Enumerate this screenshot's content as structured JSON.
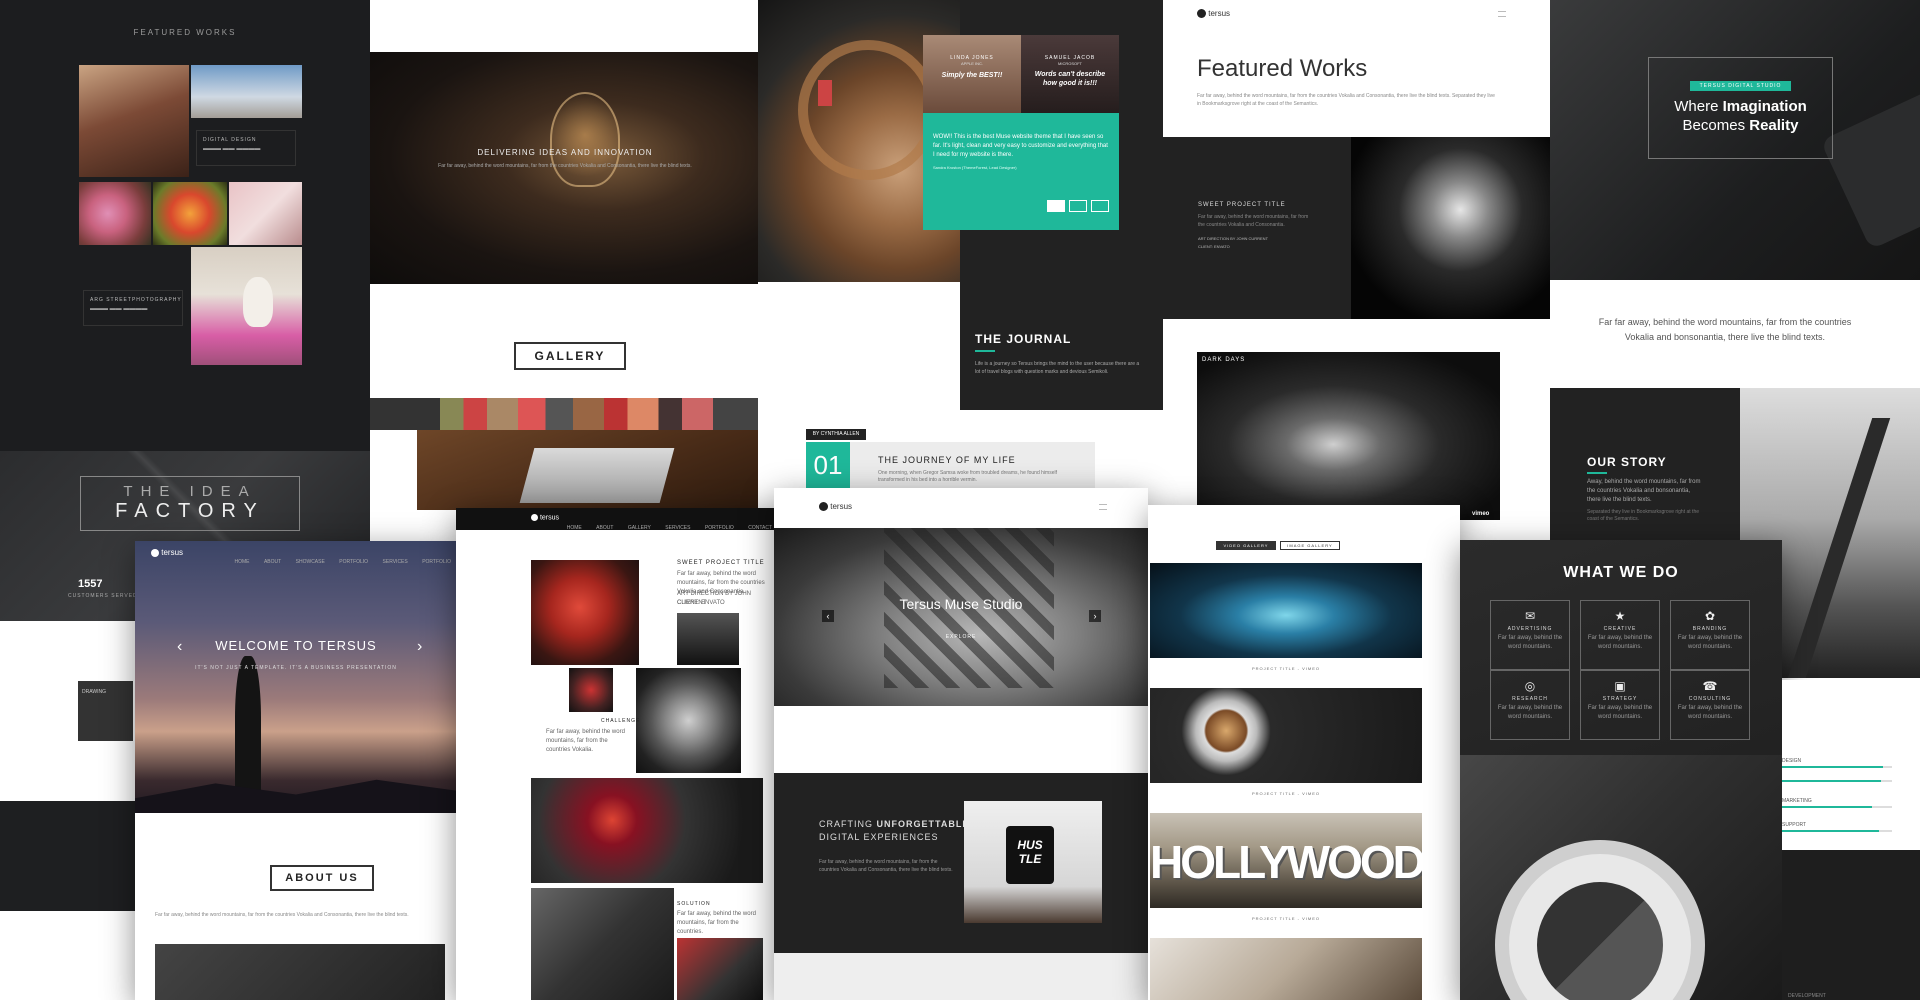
{
  "brand": {
    "name": "tersus"
  },
  "featured_dark": {
    "heading": "FEATURED WORKS",
    "caption1_title": "DIGITAL DESIGN",
    "caption2_title": "ARG STREETPHOTOGRAPHY"
  },
  "bulb_panel": {
    "heading": "DELIVERING IDEAS AND INNOVATION",
    "body": "Far far away, behind the word mountains, far from the countries Vokalia and Consonantia, there live the blind texts.",
    "gallery_button": "GALLERY"
  },
  "idea_factory": {
    "line1": "THE IDEA",
    "line2": "FACTORY"
  },
  "stats": {
    "number": "1557",
    "label": "CUSTOMERS SERVED",
    "side_label": "DRAWING"
  },
  "testimonials": {
    "person1_name": "LINDA JONES",
    "person1_role": "APPLE INC.",
    "person1_quote": "Simply the BEST!!",
    "person2_name": "SAMUEL JACOB",
    "person2_role": "MICROSOFT",
    "person2_quote": "Words can't describe how good it is!!!",
    "teal_quote": "WOW!! This is the best Muse website theme that I have seen so far. It's light, clean and very easy to customize and everything that I need for my website is there.",
    "teal_author": "Sandra Kroston (ThemeForest, Lead Designer)"
  },
  "journal": {
    "heading": "THE JOURNAL",
    "body": "Life is a journey so Tersus brings the mind to the user because there are a lot of travel blogs with question marks and devious Semikoli.",
    "author_tag": "BY CYNTHIA ALLEN",
    "day": "01",
    "post_title": "THE JOURNEY OF MY LIFE",
    "post_body": "One morning, when Gregor Samsa woke from troubled dreams, he found himself transformed in his bed into a horrible vermin."
  },
  "featured_light": {
    "title_light": "Featured",
    "title_bold": "Works",
    "body": "Far far away, behind the word mountains, far from the countries Vokalia and Consonantia, there live the blind texts. Separated they live in Bookmarksgrove right at the coast of the Semantics.",
    "project_title": "SWEET PROJECT TITLE",
    "project_body": "Far far away, behind the word mountains, far from the countries Vokalia and Consonantia.",
    "art_direction": "ART DIRECTION BY JOHN CURRENT",
    "client": "CLIENT: ENVATO",
    "dark_days": "DARK DAYS",
    "vimeo": "vimeo"
  },
  "imagination": {
    "tag": "TERSUS DIGITAL STUDIO",
    "line1_light": "Where",
    "line1_bold": "Imagination",
    "line2_light": "Becomes",
    "line2_bold": "Reality",
    "tagline": "Far far away, behind the word mountains, far from the countries Vokalia and bonsonantia, there live the blind texts.",
    "story_heading": "OUR STORY",
    "story_body": "Away, behind the word mountains, far from the countries Vokalia and bonsonantia, there live the blind texts.",
    "story_more": "Separated they live in Bookmarksgrove right at the coast of the Semantics."
  },
  "welcome": {
    "nav": [
      "HOME",
      "ABOUT",
      "SHOWCASE",
      "PORTFOLIO",
      "SERVICES",
      "PORTFOLIO"
    ],
    "hero_title": "WELCOME TO TERSUS",
    "hero_sub": "IT'S NOT JUST A TEMPLATE. IT'S A BUSINESS PRESENTATION",
    "about_button": "ABOUT US",
    "about_body": "Far far away, behind the word mountains, far from the countries Vokalia and Consonantia, there live the blind texts."
  },
  "project_page": {
    "nav": [
      "HOME",
      "ABOUT",
      "GALLERY",
      "SERVICES",
      "PORTFOLIO",
      "CONTACT"
    ],
    "title": "SWEET PROJECT TITLE",
    "body": "Far far away, behind the word mountains, far from the countries Vokalia and Consonantia.",
    "art_direction": "ART DIRECTION BY JOHN CURRENT",
    "client": "CLIENT: ENVATO",
    "challenge": "CHALLENGE",
    "challenge_body": "Far far away, behind the word mountains, far from the countries Vokalia.",
    "solution": "SOLUTION",
    "solution_body": "Far far away, behind the word mountains, far from the countries."
  },
  "muse": {
    "hero_title": "Tersus Muse Studio",
    "explore": "EXPLORE",
    "crafting_light": "CRAFTING",
    "crafting_bold": "UNFORGETTABLE",
    "crafting_line2": "DIGITAL EXPERIENCES",
    "crafting_body": "Far far away, behind the word mountains, far from the countries Vokalia and Consonantia, there live the blind texts.",
    "mug_text": "HUS TLE"
  },
  "video_gallery": {
    "tab1": "VIDEO GALLERY",
    "tab2": "IMAGE GALLERY",
    "caption": "PROJECT TITLE - VIMEO",
    "hollywood": "HOLLYWOOD"
  },
  "what_we_do": {
    "heading": "WHAT WE DO",
    "services": [
      {
        "icon": "megaphone-icon",
        "glyph": "✉",
        "name": "ADVERTISING"
      },
      {
        "icon": "star-icon",
        "glyph": "★",
        "name": "CREATIVE"
      },
      {
        "icon": "lotus-icon",
        "glyph": "✿",
        "name": "BRANDING"
      },
      {
        "icon": "research-icon",
        "glyph": "◎",
        "name": "RESEARCH"
      },
      {
        "icon": "strategy-icon",
        "glyph": "▣",
        "name": "STRATEGY"
      },
      {
        "icon": "consulting-icon",
        "glyph": "☎",
        "name": "CONSULTING"
      }
    ],
    "service_body": "Far far away, behind the word mountains.",
    "skills": [
      {
        "name": "DESIGN",
        "level": 0.92
      },
      {
        "name": "",
        "level": 0.9
      },
      {
        "name": "MARKETING",
        "level": 0.82
      },
      {
        "name": "SUPPORT",
        "level": 0.88
      }
    ],
    "footer_label": "DEVELOPMENT"
  },
  "colors": {
    "accent": "#1fb89a",
    "dark": "#1e1f21"
  }
}
